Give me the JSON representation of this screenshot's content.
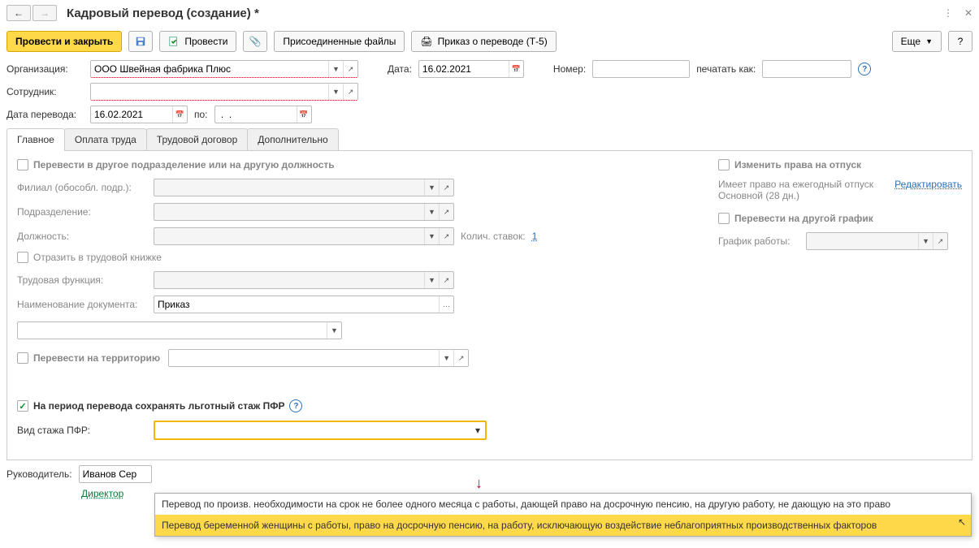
{
  "title": "Кадровый перевод (создание) *",
  "toolbar": {
    "post_close": "Провести и закрыть",
    "post": "Провести",
    "attached_files": "Присоединенные файлы",
    "print_order": "Приказ о переводе (Т-5)",
    "more": "Еще"
  },
  "header": {
    "org_label": "Организация:",
    "org_value": "ООО Швейная фабрика Плюс",
    "date_label": "Дата:",
    "date_value": "16.02.2021",
    "number_label": "Номер:",
    "print_as_label": "печатать как:",
    "employee_label": "Сотрудник:",
    "transfer_date_label": "Дата перевода:",
    "transfer_date_value": "16.02.2021",
    "to_label": "по:",
    "to_value": " .  ."
  },
  "tabs": [
    "Главное",
    "Оплата труда",
    "Трудовой договор",
    "Дополнительно"
  ],
  "main": {
    "chk_transfer_dept": "Перевести в другое подразделение или на другую должность",
    "branch_label": "Филиал (обособл. подр.):",
    "department_label": "Подразделение:",
    "position_label": "Должность:",
    "rates_label": "Колич. ставок:",
    "rates_value": "1",
    "chk_workbook": "Отразить в трудовой книжке",
    "workfunc_label": "Трудовая функция:",
    "docname_label": "Наименование документа:",
    "docname_value": "Приказ",
    "chk_territory": "Перевести на территорию",
    "chk_pfr": "На период перевода сохранять льготный стаж ПФР",
    "stazh_label": "Вид стажа ПФР:"
  },
  "right": {
    "chk_vacation": "Изменить права на отпуск",
    "vacation_text": "Имеет право на ежегодный отпуск Основной (28 дн.)",
    "edit_link": "Редактировать",
    "chk_schedule": "Перевести на другой график",
    "schedule_label": "График работы:"
  },
  "dropdown": {
    "items": [
      "Перевод по произв. необходимости на срок не более одного месяца с работы, дающей право на досрочную пенсию, на другую работу, не дающую на это право",
      "Перевод беременной женщины с работы, право на досрочную пенсию, на работу, исключающую воздействие неблагоприятных производственных факторов"
    ]
  },
  "footer": {
    "manager_label": "Руководитель:",
    "manager_value": "Иванов Сер",
    "director_link": "Директор"
  }
}
